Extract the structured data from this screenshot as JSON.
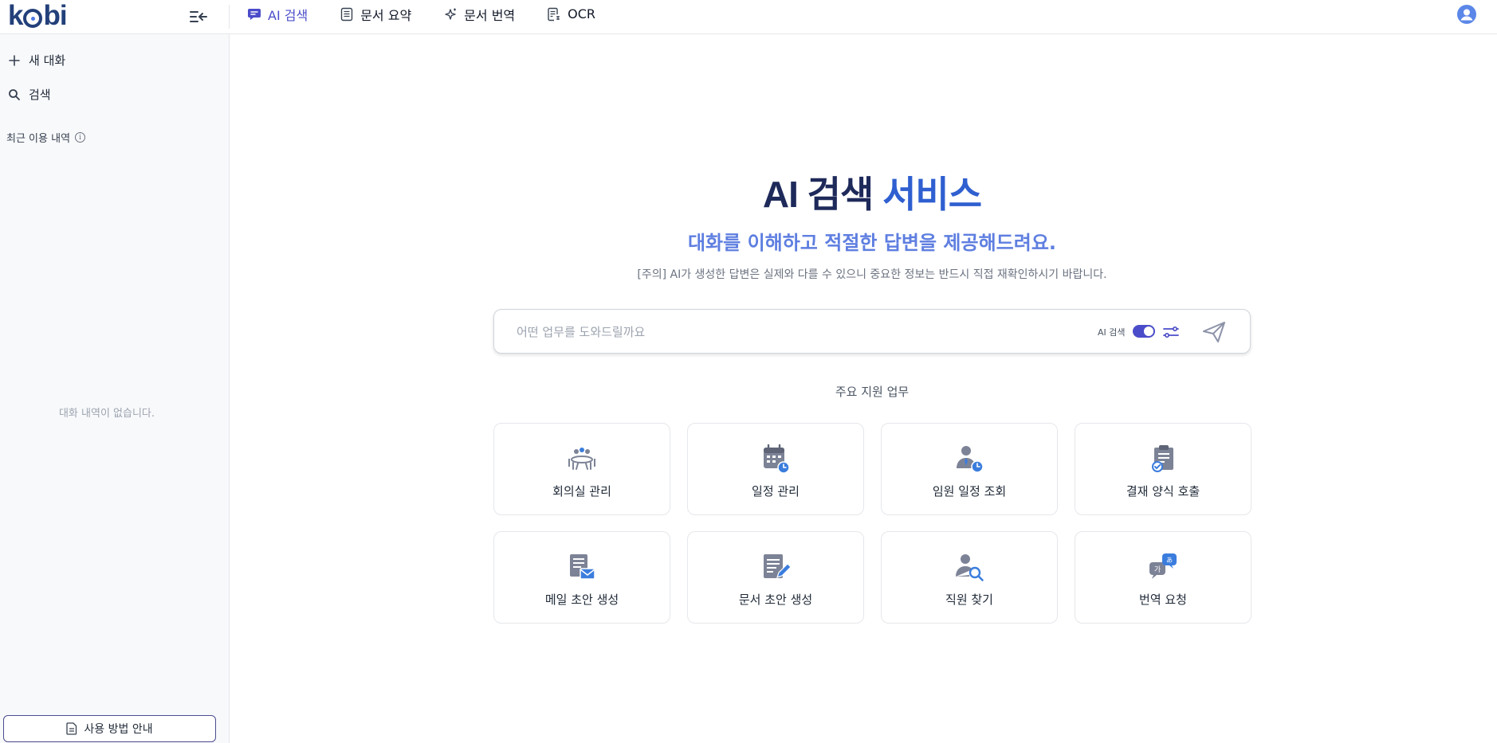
{
  "app": {
    "logo_text": "kobi"
  },
  "header": {
    "tabs": [
      {
        "label": "AI 검색",
        "icon": "chat-bubble-icon",
        "active": true
      },
      {
        "label": "문서 요약",
        "icon": "document-list-icon",
        "active": false
      },
      {
        "label": "문서 번역",
        "icon": "sparkle-icon",
        "active": false
      },
      {
        "label": "OCR",
        "icon": "scan-document-icon",
        "active": false
      }
    ]
  },
  "sidebar": {
    "new_chat": "새 대화",
    "search": "검색",
    "recent_label": "최근 이용 내역",
    "empty_text": "대화 내역이 없습니다.",
    "guide_button": "사용 방법 안내"
  },
  "hero": {
    "title_part1": "AI 검색",
    "title_part2": "서비스",
    "subtitle": "대화를 이해하고 적절한 답변을 제공해드려요.",
    "notice": "[주의] AI가 생성한 답변은 실제와 다를 수 있으니 중요한 정보는 반드시 직접 재확인하시기 바랍니다."
  },
  "chat": {
    "placeholder": "어떤 업무를 도와드릴까요",
    "toggle_label": "AI 검색",
    "toggle_on": true
  },
  "tasks": {
    "section_label": "주요 지원 업무",
    "items": [
      {
        "label": "회의실 관리",
        "icon": "meeting-room-icon"
      },
      {
        "label": "일정 관리",
        "icon": "calendar-icon"
      },
      {
        "label": "임원 일정 조회",
        "icon": "executive-schedule-icon"
      },
      {
        "label": "결재 양식 호출",
        "icon": "approval-form-icon"
      },
      {
        "label": "메일 초안 생성",
        "icon": "mail-draft-icon"
      },
      {
        "label": "문서 초안 생성",
        "icon": "document-draft-icon"
      },
      {
        "label": "직원 찾기",
        "icon": "employee-search-icon"
      },
      {
        "label": "번역 요청",
        "icon": "translate-icon"
      }
    ]
  },
  "colors": {
    "brand": "#23407a",
    "accent": "#4b4cc9",
    "title_dark": "#1e2a5a",
    "title_blue": "#2f5fd0",
    "subtitle": "#5e7ee0",
    "icon_gray": "#7d8396",
    "icon_blue": "#3b7ddd"
  }
}
